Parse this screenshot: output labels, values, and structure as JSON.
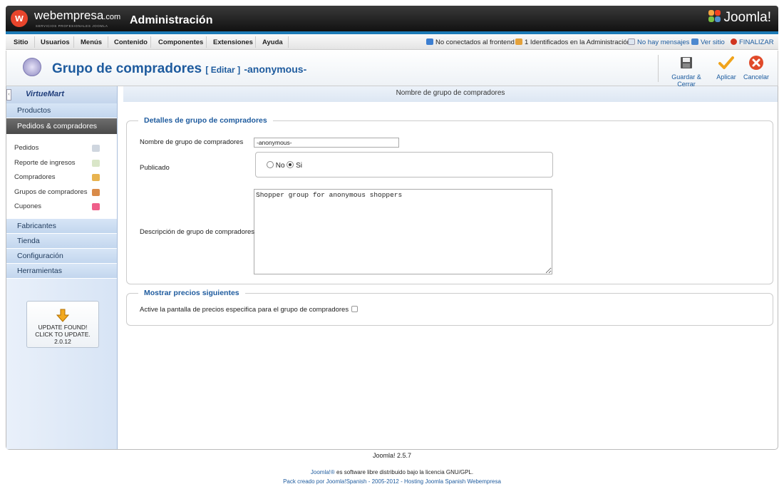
{
  "header": {
    "brand": "webempresa",
    "brand_suffix": ".com",
    "brand_sub": "SERVICIOS PROFESIONALES JOOMLA",
    "admin_title": "Administración",
    "joomla_logo": "Joomla!"
  },
  "menu": {
    "items": [
      "Sitio",
      "Usuarios",
      "Menús",
      "Contenido",
      "Componentes",
      "Extensiones",
      "Ayuda"
    ]
  },
  "status": {
    "frontend": "No conectados al frontend",
    "admin": "1 Identificados en la Administración",
    "messages": "No hay mensajes",
    "view_site": "Ver sitio",
    "logout": "FINALIZAR"
  },
  "toolbar": {
    "title": "Grupo de compradores",
    "edit_label": "[ Editar ]",
    "record_name": "-anonymous-",
    "save_close": "Guardar & Cerrar",
    "apply": "Aplicar",
    "cancel": "Cancelar"
  },
  "sidebar": {
    "logo": "VirtueMart",
    "sections_top": [
      "Productos",
      "Pedidos & compradores"
    ],
    "subitems": [
      "Pedidos",
      "Reporte de ingresos",
      "Compradores",
      "Grupos de compradores",
      "Cupones"
    ],
    "sections_bottom": [
      "Fabricantes",
      "Tienda",
      "Configuración",
      "Herramientas"
    ],
    "update": {
      "line1": "UPDATE FOUND!",
      "line2": "CLICK TO UPDATE.",
      "version": "2.0.12"
    }
  },
  "content": {
    "tab_title": "Nombre de grupo de compradores",
    "details": {
      "legend": "Detalles de grupo de compradores",
      "name_label": "Nombre de grupo de compradores",
      "name_value": "-anonymous-",
      "published_label": "Publicado",
      "published_no": "No",
      "published_yes": "Si",
      "published_value": "Si",
      "description_label": "Descripción de grupo de compradores",
      "description_value": "Shopper group for anonymous shoppers"
    },
    "prices": {
      "legend": "Mostrar precios siguientes",
      "checkbox_label": "Active la pantalla de precios especifica para el grupo de compradores",
      "checked": false
    }
  },
  "footer": {
    "version": "Joomla! 2.5.7",
    "license_link": "Joomla!®",
    "license_text": " es software libre distribuido bajo la licencia GNU/GPL.",
    "pack": "Pack creado por Joomla!Spanish - 2005-2012 - Hosting Joomla Spanish Webempresa"
  },
  "colors": {
    "accent": "#1e5b9e",
    "header_bg": "#1a1a1a",
    "header_stripe": "#1c79b5",
    "active_section": "#555555"
  }
}
